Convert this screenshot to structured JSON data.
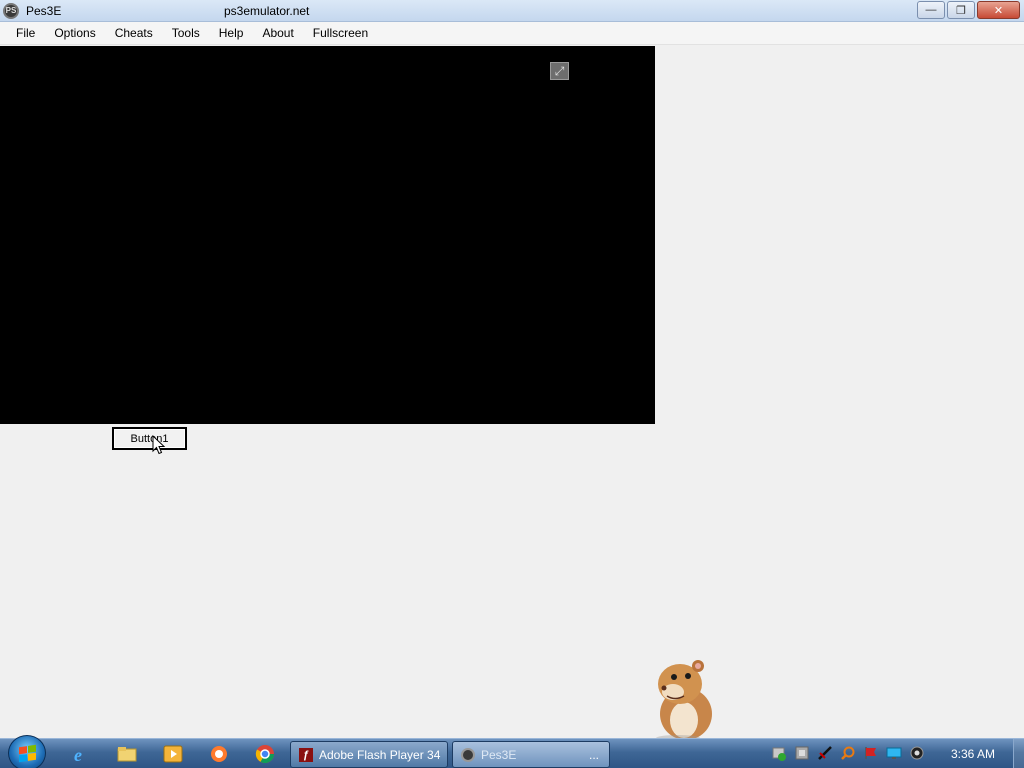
{
  "window": {
    "title": "Pes3E",
    "url_text": "ps3emulator.net",
    "app_icon_label": "PS",
    "controls": {
      "minimize": "—",
      "restore": "❐",
      "close": "✕"
    }
  },
  "menu": [
    {
      "name": "menu-file",
      "label": "File"
    },
    {
      "name": "menu-options",
      "label": "Options"
    },
    {
      "name": "menu-cheats",
      "label": "Cheats"
    },
    {
      "name": "menu-tools",
      "label": "Tools"
    },
    {
      "name": "menu-help",
      "label": "Help"
    },
    {
      "name": "menu-about",
      "label": "About"
    },
    {
      "name": "menu-fullscreen",
      "label": "Fullscreen"
    }
  ],
  "flash_area": {
    "background": "#000000",
    "expand_icon": "⤢"
  },
  "button1": {
    "label": "Button1"
  },
  "taskbar": {
    "pinned": [
      "ie-icon",
      "explorer-icon",
      "media-player-icon",
      "app-icon",
      "chrome-icon"
    ],
    "tasks": [
      {
        "label": "Adobe Flash Player 34",
        "icon": "flash-icon"
      },
      {
        "label": "Pes3E",
        "suffix": "...",
        "icon": "pes3e-icon"
      }
    ],
    "tray_icons": [
      "security-icon",
      "network-icon",
      "tool-icon",
      "search-icon",
      "flag-icon",
      "monitor-icon",
      "speaker-icon"
    ],
    "clock": "3:36 AM"
  },
  "colors": {
    "accent": "#3f6796",
    "flash_bg": "#000000",
    "window_bg": "#f0f0f0",
    "close_red": "#c74a35"
  }
}
